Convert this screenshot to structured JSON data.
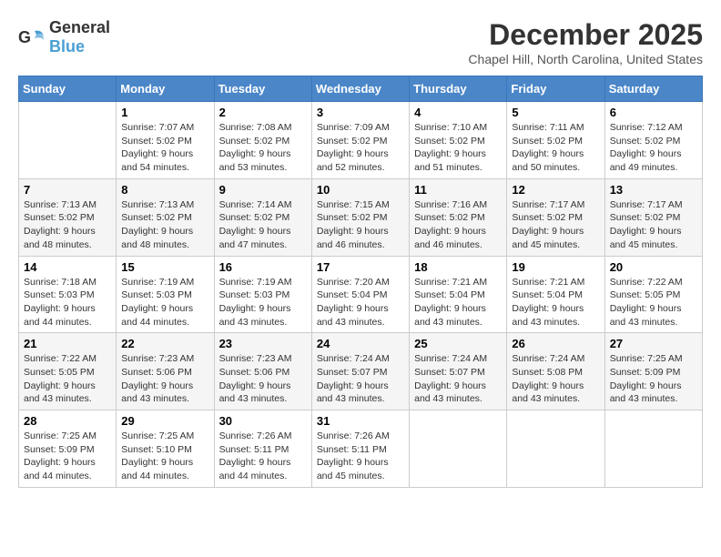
{
  "header": {
    "logo_general": "General",
    "logo_blue": "Blue",
    "month": "December 2025",
    "location": "Chapel Hill, North Carolina, United States"
  },
  "weekdays": [
    "Sunday",
    "Monday",
    "Tuesday",
    "Wednesday",
    "Thursday",
    "Friday",
    "Saturday"
  ],
  "weeks": [
    [
      {
        "day": "",
        "sunrise": "",
        "sunset": "",
        "daylight": ""
      },
      {
        "day": "1",
        "sunrise": "Sunrise: 7:07 AM",
        "sunset": "Sunset: 5:02 PM",
        "daylight": "Daylight: 9 hours and 54 minutes."
      },
      {
        "day": "2",
        "sunrise": "Sunrise: 7:08 AM",
        "sunset": "Sunset: 5:02 PM",
        "daylight": "Daylight: 9 hours and 53 minutes."
      },
      {
        "day": "3",
        "sunrise": "Sunrise: 7:09 AM",
        "sunset": "Sunset: 5:02 PM",
        "daylight": "Daylight: 9 hours and 52 minutes."
      },
      {
        "day": "4",
        "sunrise": "Sunrise: 7:10 AM",
        "sunset": "Sunset: 5:02 PM",
        "daylight": "Daylight: 9 hours and 51 minutes."
      },
      {
        "day": "5",
        "sunrise": "Sunrise: 7:11 AM",
        "sunset": "Sunset: 5:02 PM",
        "daylight": "Daylight: 9 hours and 50 minutes."
      },
      {
        "day": "6",
        "sunrise": "Sunrise: 7:12 AM",
        "sunset": "Sunset: 5:02 PM",
        "daylight": "Daylight: 9 hours and 49 minutes."
      }
    ],
    [
      {
        "day": "7",
        "sunrise": "Sunrise: 7:13 AM",
        "sunset": "Sunset: 5:02 PM",
        "daylight": "Daylight: 9 hours and 48 minutes."
      },
      {
        "day": "8",
        "sunrise": "Sunrise: 7:13 AM",
        "sunset": "Sunset: 5:02 PM",
        "daylight": "Daylight: 9 hours and 48 minutes."
      },
      {
        "day": "9",
        "sunrise": "Sunrise: 7:14 AM",
        "sunset": "Sunset: 5:02 PM",
        "daylight": "Daylight: 9 hours and 47 minutes."
      },
      {
        "day": "10",
        "sunrise": "Sunrise: 7:15 AM",
        "sunset": "Sunset: 5:02 PM",
        "daylight": "Daylight: 9 hours and 46 minutes."
      },
      {
        "day": "11",
        "sunrise": "Sunrise: 7:16 AM",
        "sunset": "Sunset: 5:02 PM",
        "daylight": "Daylight: 9 hours and 46 minutes."
      },
      {
        "day": "12",
        "sunrise": "Sunrise: 7:17 AM",
        "sunset": "Sunset: 5:02 PM",
        "daylight": "Daylight: 9 hours and 45 minutes."
      },
      {
        "day": "13",
        "sunrise": "Sunrise: 7:17 AM",
        "sunset": "Sunset: 5:02 PM",
        "daylight": "Daylight: 9 hours and 45 minutes."
      }
    ],
    [
      {
        "day": "14",
        "sunrise": "Sunrise: 7:18 AM",
        "sunset": "Sunset: 5:03 PM",
        "daylight": "Daylight: 9 hours and 44 minutes."
      },
      {
        "day": "15",
        "sunrise": "Sunrise: 7:19 AM",
        "sunset": "Sunset: 5:03 PM",
        "daylight": "Daylight: 9 hours and 44 minutes."
      },
      {
        "day": "16",
        "sunrise": "Sunrise: 7:19 AM",
        "sunset": "Sunset: 5:03 PM",
        "daylight": "Daylight: 9 hours and 43 minutes."
      },
      {
        "day": "17",
        "sunrise": "Sunrise: 7:20 AM",
        "sunset": "Sunset: 5:04 PM",
        "daylight": "Daylight: 9 hours and 43 minutes."
      },
      {
        "day": "18",
        "sunrise": "Sunrise: 7:21 AM",
        "sunset": "Sunset: 5:04 PM",
        "daylight": "Daylight: 9 hours and 43 minutes."
      },
      {
        "day": "19",
        "sunrise": "Sunrise: 7:21 AM",
        "sunset": "Sunset: 5:04 PM",
        "daylight": "Daylight: 9 hours and 43 minutes."
      },
      {
        "day": "20",
        "sunrise": "Sunrise: 7:22 AM",
        "sunset": "Sunset: 5:05 PM",
        "daylight": "Daylight: 9 hours and 43 minutes."
      }
    ],
    [
      {
        "day": "21",
        "sunrise": "Sunrise: 7:22 AM",
        "sunset": "Sunset: 5:05 PM",
        "daylight": "Daylight: 9 hours and 43 minutes."
      },
      {
        "day": "22",
        "sunrise": "Sunrise: 7:23 AM",
        "sunset": "Sunset: 5:06 PM",
        "daylight": "Daylight: 9 hours and 43 minutes."
      },
      {
        "day": "23",
        "sunrise": "Sunrise: 7:23 AM",
        "sunset": "Sunset: 5:06 PM",
        "daylight": "Daylight: 9 hours and 43 minutes."
      },
      {
        "day": "24",
        "sunrise": "Sunrise: 7:24 AM",
        "sunset": "Sunset: 5:07 PM",
        "daylight": "Daylight: 9 hours and 43 minutes."
      },
      {
        "day": "25",
        "sunrise": "Sunrise: 7:24 AM",
        "sunset": "Sunset: 5:07 PM",
        "daylight": "Daylight: 9 hours and 43 minutes."
      },
      {
        "day": "26",
        "sunrise": "Sunrise: 7:24 AM",
        "sunset": "Sunset: 5:08 PM",
        "daylight": "Daylight: 9 hours and 43 minutes."
      },
      {
        "day": "27",
        "sunrise": "Sunrise: 7:25 AM",
        "sunset": "Sunset: 5:09 PM",
        "daylight": "Daylight: 9 hours and 43 minutes."
      }
    ],
    [
      {
        "day": "28",
        "sunrise": "Sunrise: 7:25 AM",
        "sunset": "Sunset: 5:09 PM",
        "daylight": "Daylight: 9 hours and 44 minutes."
      },
      {
        "day": "29",
        "sunrise": "Sunrise: 7:25 AM",
        "sunset": "Sunset: 5:10 PM",
        "daylight": "Daylight: 9 hours and 44 minutes."
      },
      {
        "day": "30",
        "sunrise": "Sunrise: 7:26 AM",
        "sunset": "Sunset: 5:11 PM",
        "daylight": "Daylight: 9 hours and 44 minutes."
      },
      {
        "day": "31",
        "sunrise": "Sunrise: 7:26 AM",
        "sunset": "Sunset: 5:11 PM",
        "daylight": "Daylight: 9 hours and 45 minutes."
      },
      {
        "day": "",
        "sunrise": "",
        "sunset": "",
        "daylight": ""
      },
      {
        "day": "",
        "sunrise": "",
        "sunset": "",
        "daylight": ""
      },
      {
        "day": "",
        "sunrise": "",
        "sunset": "",
        "daylight": ""
      }
    ]
  ]
}
